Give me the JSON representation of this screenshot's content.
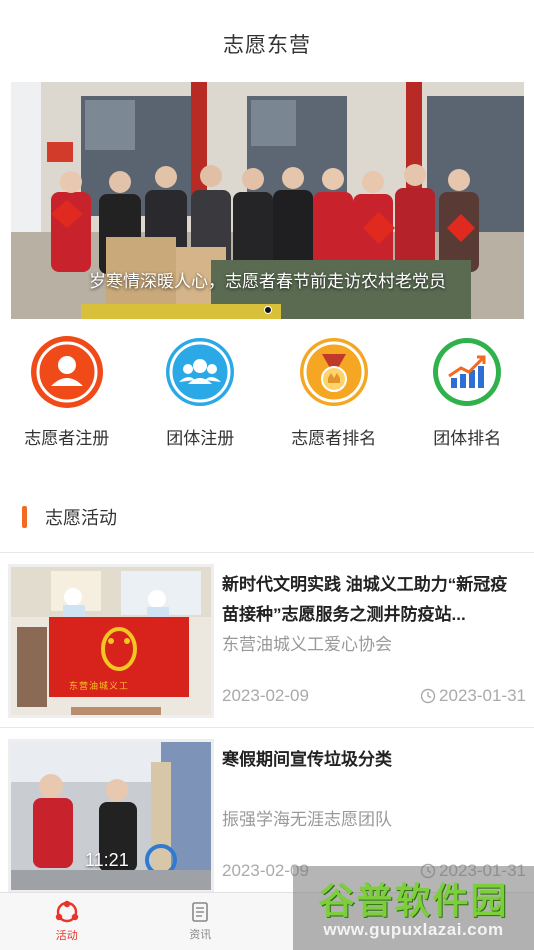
{
  "header": {
    "title": "志愿东营"
  },
  "banner": {
    "caption": "岁寒情深暖人心，志愿者春节前走访农村老党员",
    "slide_count": 1,
    "active_index": 0
  },
  "quick_links": [
    {
      "label": "志愿者注册",
      "icon": "person-icon",
      "color": "#f04a18"
    },
    {
      "label": "团体注册",
      "icon": "group-icon",
      "color": "#2aa9e6"
    },
    {
      "label": "志愿者排名",
      "icon": "medal-icon",
      "color": "#f5a623"
    },
    {
      "label": "团体排名",
      "icon": "chart-up-icon",
      "color": "#2fb24c"
    }
  ],
  "section": {
    "title": "志愿活动"
  },
  "activities": [
    {
      "title": "新时代文明实践 油城义工助力“新冠疫苗接种”志愿服务之测井防疫站...",
      "org": "东营油城义工爱心协会",
      "date_start": "2023-02-09",
      "date_end": "2023-01-31",
      "flag_text": "东营油城义工"
    },
    {
      "title": "寒假期间宣传垃圾分类",
      "org": "振强学海无涯志愿团队",
      "date_start": "2023-02-09",
      "date_end": "2023-01-31",
      "photo_time": "11:21"
    }
  ],
  "tabbar": [
    {
      "label": "活动",
      "icon": "activity-icon",
      "active": true
    },
    {
      "label": "资讯",
      "icon": "news-icon",
      "active": false
    }
  ],
  "watermark": {
    "main": "谷普软件园",
    "sub": "www.gupuxlazai.com"
  },
  "colors": {
    "accent": "#f26a21",
    "tab_active": "#e8342a"
  }
}
